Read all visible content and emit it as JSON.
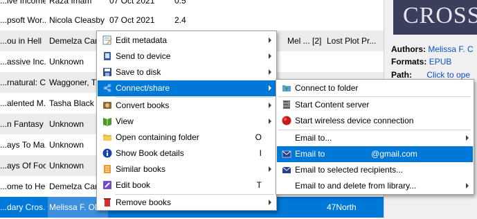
{
  "table": {
    "rows": [
      {
        "title": "...ive Income...",
        "author": "Raza Imam",
        "date": "07 Oct 2021",
        "rating": "0.5",
        "extra1": "",
        "extra2": ""
      },
      {
        "title": "...psoft Wor...",
        "author": "Nicola Cleasby",
        "date": "07 Oct 2021",
        "rating": "2.4",
        "extra1": "",
        "extra2": ""
      },
      {
        "title": "...ou in Hell",
        "author": "Demelza Car...",
        "date": "",
        "rating": "",
        "extra1": "Mel ... [2]",
        "extra2": "Lost Plot Pr..."
      },
      {
        "title": "...assive Inc...",
        "author": "Unknown",
        "date": "",
        "rating": "",
        "extra1": "",
        "extra2": ""
      },
      {
        "title": "...rnatural: C...",
        "author": "Waggoner, T...",
        "date": "",
        "rating": "",
        "extra1": "",
        "extra2": ""
      },
      {
        "title": "...alented M...",
        "author": "Tasha Black",
        "date": "",
        "rating": "",
        "extra1": "",
        "extra2": ""
      },
      {
        "title": "...n Fantasy ...",
        "author": "Unknown",
        "date": "",
        "rating": "",
        "extra1": "",
        "extra2": ""
      },
      {
        "title": "...ays To Ma...",
        "author": "Unknown",
        "date": "",
        "rating": "",
        "extra1": "",
        "extra2": ""
      },
      {
        "title": "...ays Of Focus",
        "author": "Unknown",
        "date": "",
        "rating": "",
        "extra1": "",
        "extra2": ""
      },
      {
        "title": "...ome to Hell",
        "author": "Demelza Car...",
        "date": "",
        "rating": "",
        "extra1": "",
        "extra2": ""
      },
      {
        "title": "...dary Cros...",
        "author": "Melissa F. Ol...",
        "date": "",
        "rating": "",
        "extra1": "",
        "extra2": "47North"
      }
    ]
  },
  "details": {
    "cover_text": "CROSS",
    "authors_label": "Authors:",
    "authors_value": "Melissa F. C",
    "formats_label": "Formats:",
    "formats_value": "EPUB",
    "path_label": "Path:",
    "path_value": "Click to ope"
  },
  "context_menu": {
    "items": [
      {
        "label": "Edit metadata",
        "shortcut": "",
        "icon": "edit-metadata-icon"
      },
      {
        "label": "Send to device",
        "shortcut": "",
        "icon": "send-to-device-icon"
      },
      {
        "label": "Save to disk",
        "shortcut": "",
        "icon": "save-disk-icon"
      },
      {
        "label": "Connect/share",
        "shortcut": "",
        "icon": "connect-share-icon"
      },
      {
        "label": "Convert books",
        "shortcut": "",
        "icon": "convert-books-icon"
      },
      {
        "label": "View",
        "shortcut": "",
        "icon": "view-icon"
      },
      {
        "label": "Open containing folder",
        "shortcut": "O",
        "icon": "folder-icon"
      },
      {
        "label": "Show Book details",
        "shortcut": "I",
        "icon": "info-icon"
      },
      {
        "label": "Similar books",
        "shortcut": "",
        "icon": "similar-books-icon"
      },
      {
        "label": "Edit book",
        "shortcut": "T",
        "icon": "edit-book-icon"
      },
      {
        "label": "Remove books",
        "shortcut": "",
        "icon": "remove-books-icon"
      }
    ]
  },
  "share_submenu": {
    "items": [
      {
        "label": "Connect to folder",
        "icon": "connect-folder-icon"
      },
      {
        "label": "Start Content server",
        "icon": "server-icon"
      },
      {
        "label": "Start wireless device connection",
        "icon": "wireless-red-icon"
      },
      {
        "label": "Email to...",
        "icon": ""
      },
      {
        "label": "Email to                    @gmail.com",
        "icon": "email-icon"
      },
      {
        "label": "Email to selected recipients...",
        "icon": "email-icon"
      },
      {
        "label": "Email to and delete from library...",
        "icon": ""
      }
    ]
  },
  "colors": {
    "selection": "#0078d7",
    "link": "#0a50c8",
    "alt_row": "#ececec"
  }
}
